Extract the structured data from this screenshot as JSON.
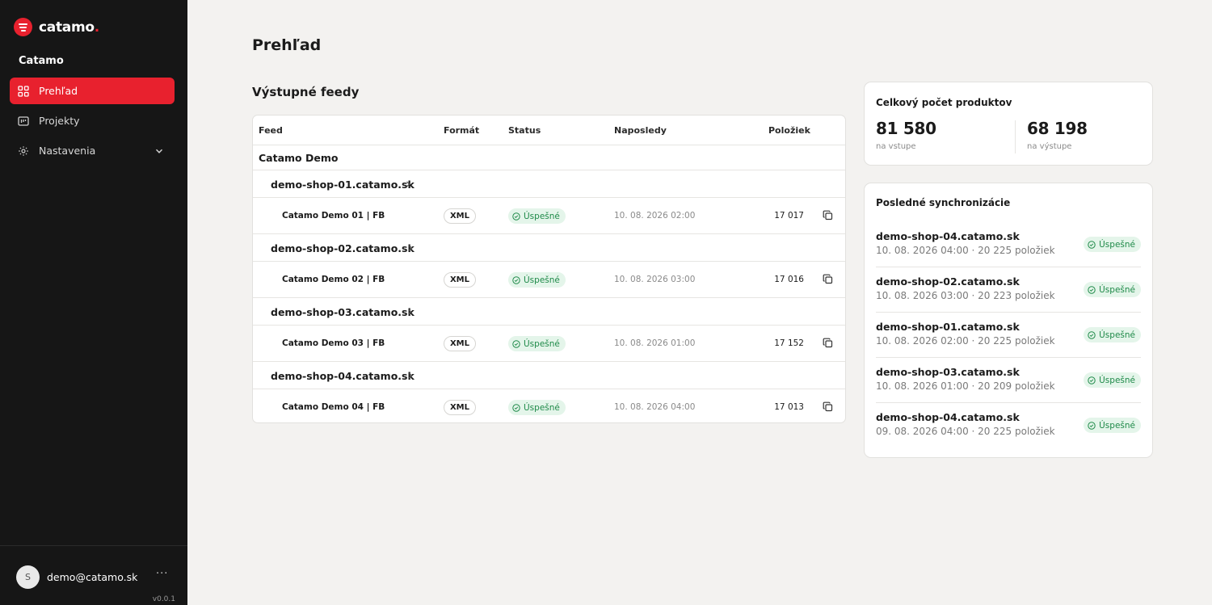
{
  "brand": {
    "name": "catamo",
    "dot": "."
  },
  "org": "Catamo",
  "nav": [
    {
      "label": "Prehľad",
      "icon": "grid-icon",
      "active": true
    },
    {
      "label": "Projekty",
      "icon": "projects-icon"
    },
    {
      "label": "Nastavenia",
      "icon": "gear-icon"
    }
  ],
  "user": {
    "initial": "S",
    "email": "demo@catamo.sk",
    "more": "···",
    "version": "v0.0.1"
  },
  "page": {
    "title": "Prehľad",
    "section": "Výstupné feedy"
  },
  "table": {
    "headers": {
      "feed": "Feed",
      "format": "Formát",
      "status": "Status",
      "last": "Naposledy",
      "items": "Položiek"
    },
    "group": "Catamo Demo",
    "domains": [
      {
        "name": "demo-shop-01.catamo.sk",
        "feed": {
          "name": "Catamo Demo 01 | FB",
          "format": "XML",
          "status": "Úspešné",
          "date": "10. 08. 2026 02:00",
          "count": "17 017"
        }
      },
      {
        "name": "demo-shop-02.catamo.sk",
        "feed": {
          "name": "Catamo Demo 02 | FB",
          "format": "XML",
          "status": "Úspešné",
          "date": "10. 08. 2026 03:00",
          "count": "17 016"
        }
      },
      {
        "name": "demo-shop-03.catamo.sk",
        "feed": {
          "name": "Catamo Demo 03 | FB",
          "format": "XML",
          "status": "Úspešné",
          "date": "10. 08. 2026 01:00",
          "count": "17 152"
        }
      },
      {
        "name": "demo-shop-04.catamo.sk",
        "feed": {
          "name": "Catamo Demo 04 | FB",
          "format": "XML",
          "status": "Úspešné",
          "date": "10. 08. 2026 04:00",
          "count": "17 013"
        }
      }
    ]
  },
  "stats": {
    "title": "Celkový počet produktov",
    "input": {
      "value": "81 580",
      "label": "na vstupe"
    },
    "output": {
      "value": "68 198",
      "label": "na výstupe"
    }
  },
  "sync": {
    "title": "Posledné synchronizácie",
    "items": [
      {
        "domain": "demo-shop-04.catamo.sk",
        "meta": "10. 08. 2026 04:00 · 20 225 položiek",
        "status": "Úspešné"
      },
      {
        "domain": "demo-shop-02.catamo.sk",
        "meta": "10. 08. 2026 03:00 · 20 223 položiek",
        "status": "Úspešné"
      },
      {
        "domain": "demo-shop-01.catamo.sk",
        "meta": "10. 08. 2026 02:00 · 20 225 položiek",
        "status": "Úspešné"
      },
      {
        "domain": "demo-shop-03.catamo.sk",
        "meta": "10. 08. 2026 01:00 · 20 209 položiek",
        "status": "Úspešné"
      },
      {
        "domain": "demo-shop-04.catamo.sk",
        "meta": "09. 08. 2026 04:00 · 20 225 položiek",
        "status": "Úspešné"
      }
    ]
  },
  "colors": {
    "accent": "#e8212e",
    "sidebar": "#161616",
    "background": "#f3f2f0",
    "success_bg": "#e4f5ea",
    "success_text": "#1f8a49"
  }
}
